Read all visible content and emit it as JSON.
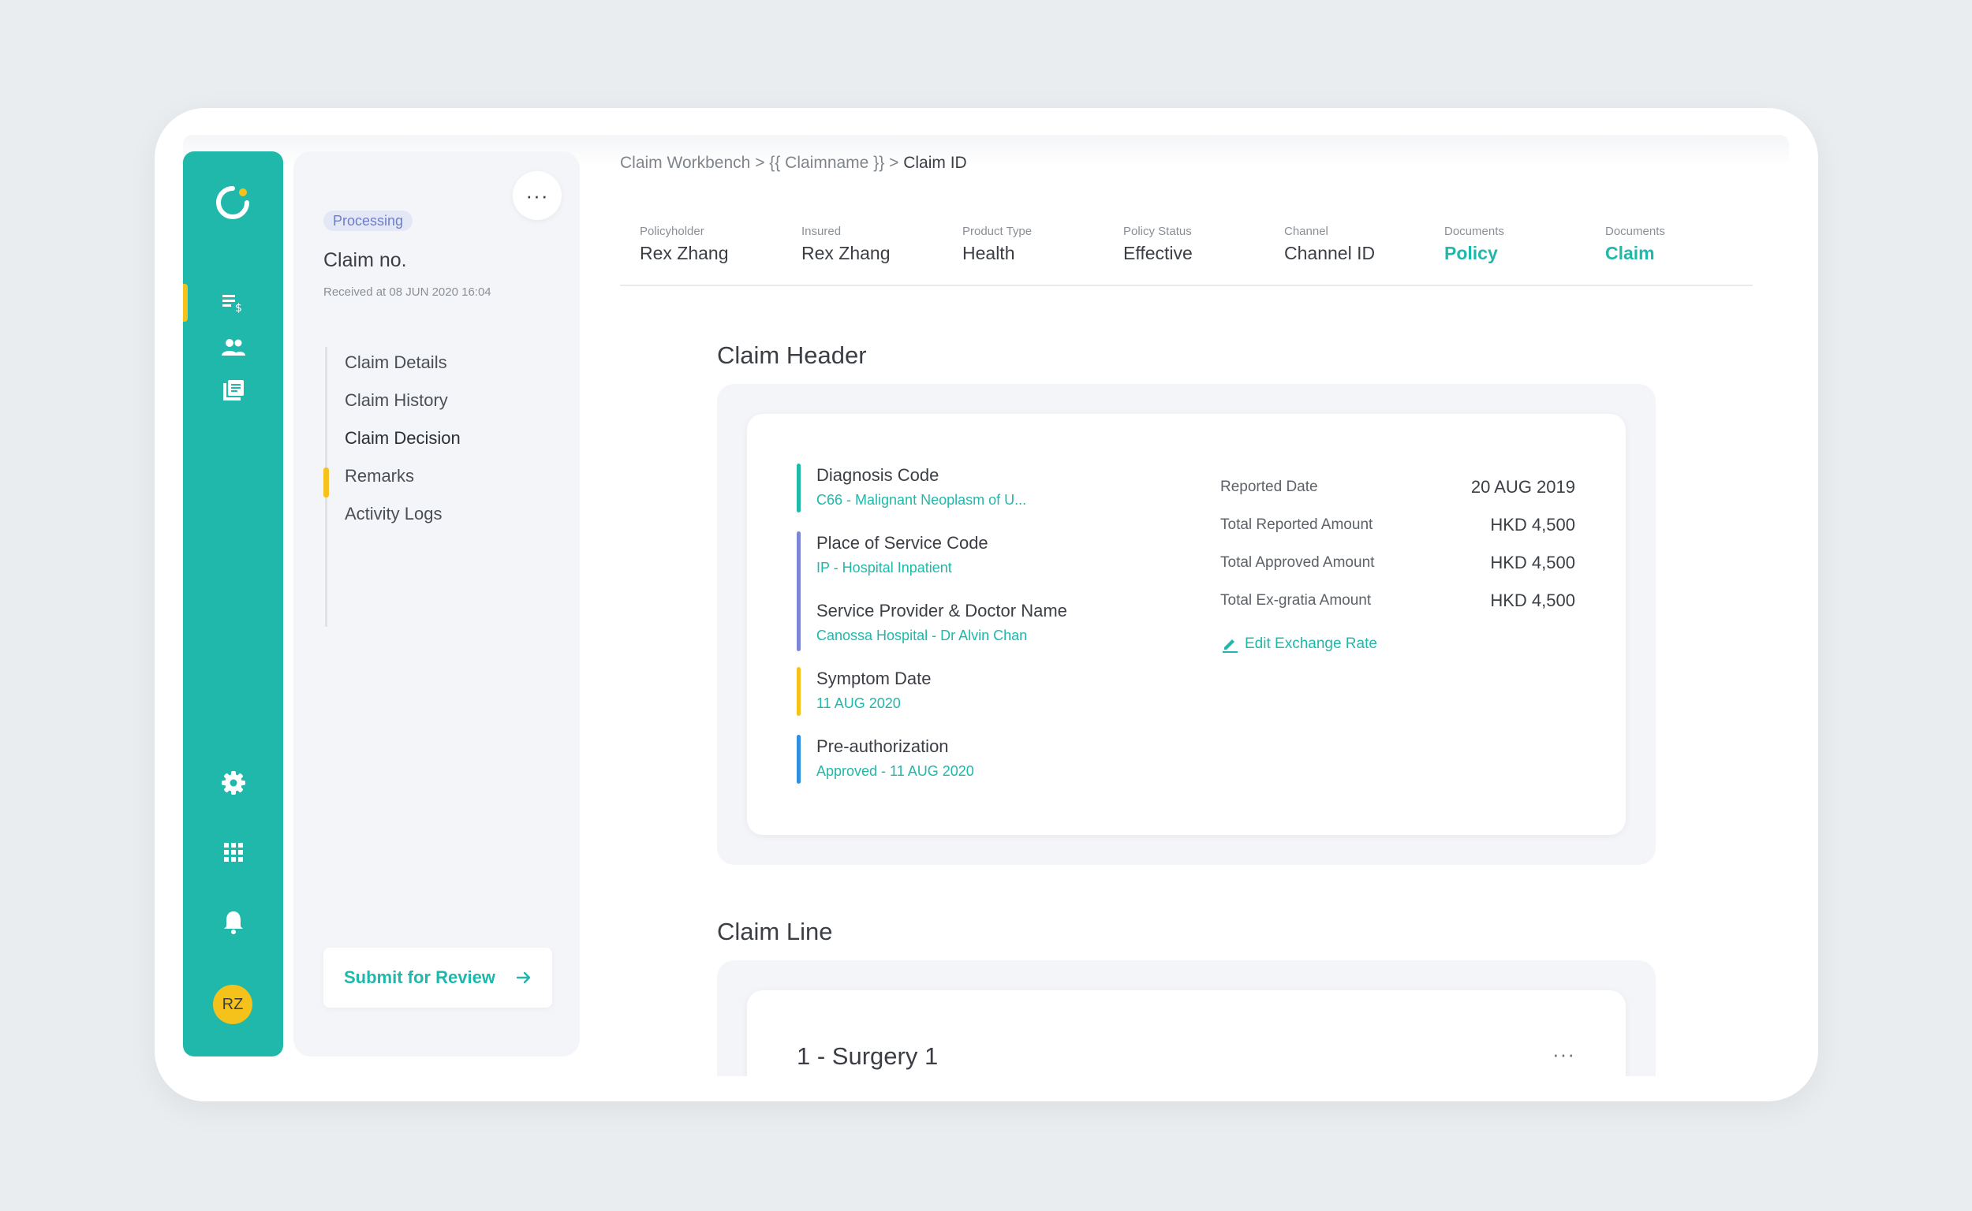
{
  "rail": {
    "logo": "logo-icon",
    "items": [
      "claims-icon",
      "people-icon",
      "documents-icon",
      "settings-icon",
      "apps-icon",
      "bell-icon"
    ],
    "avatar_initials": "RZ"
  },
  "panel": {
    "more": "···",
    "status": "Processing",
    "claim_no": "Claim no.",
    "received": "Received at 08 JUN 2020 16:04",
    "nav": [
      {
        "label": "Claim Details"
      },
      {
        "label": "Claim History"
      },
      {
        "label": "Claim Decision"
      },
      {
        "label": "Remarks"
      },
      {
        "label": "Activity Logs"
      }
    ],
    "active_nav": "Claim Decision",
    "submit": "Submit for Review"
  },
  "breadcrumb": {
    "part1": "Claim Workbench",
    "sep": ">",
    "part2": "{{ Claimname }}",
    "current": "Claim ID"
  },
  "info": [
    {
      "label": "Policyholder",
      "value": "Rex Zhang"
    },
    {
      "label": "Insured",
      "value": "Rex Zhang"
    },
    {
      "label": "Product Type",
      "value": "Health"
    },
    {
      "label": "Policy Status",
      "value": "Effective"
    },
    {
      "label": "Channel",
      "value": "Channel ID"
    },
    {
      "label": "Documents",
      "value": "Policy"
    },
    {
      "label": "Documents",
      "value": "Claim"
    }
  ],
  "claim_header": {
    "title": "Claim Header",
    "fields": [
      {
        "title": "Diagnosis Code",
        "value": "C66 - Malignant Neoplasm of U..."
      },
      {
        "title": "Place of Service Code",
        "value": "IP - Hospital Inpatient"
      },
      {
        "title": "Service Provider & Doctor Name",
        "value": "Canossa Hospital - Dr Alvin Chan"
      },
      {
        "title": "Symptom Date",
        "value": "11 AUG 2020"
      },
      {
        "title": "Pre-authorization",
        "value": "Approved - 11 AUG 2020"
      }
    ],
    "amounts": [
      {
        "label": "Reported Date",
        "value": "20 AUG 2019"
      },
      {
        "label": "Total Reported Amount",
        "value": "HKD 4,500"
      },
      {
        "label": "Total Approved Amount",
        "value": "HKD 4,500"
      },
      {
        "label": "Total Ex-gratia Amount",
        "value": "HKD 4,500"
      }
    ],
    "edit_link": "Edit Exchange Rate"
  },
  "claim_line": {
    "title": "Claim Line",
    "item_title": "1 - Surgery 1",
    "more": "···"
  },
  "colors": {
    "accent": "#1fb8aa",
    "highlight": "#f5c21b",
    "bar_purple": "#7b86d6",
    "bar_blue": "#2e8fe0"
  }
}
